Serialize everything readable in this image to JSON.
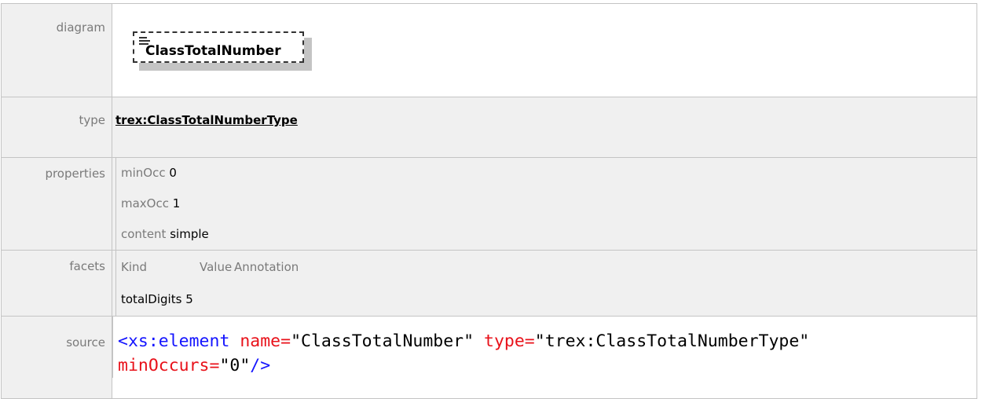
{
  "labels": {
    "diagram": "diagram",
    "type": "type",
    "properties": "properties",
    "facets": "facets",
    "source": "source"
  },
  "diagram": {
    "element_name": "ClassTotalNumber"
  },
  "type": {
    "link_text": "trex:ClassTotalNumberType"
  },
  "properties": [
    {
      "key": "minOcc",
      "value": "0"
    },
    {
      "key": "maxOcc",
      "value": "1"
    },
    {
      "key": "content",
      "value": "simple"
    }
  ],
  "facets": {
    "headers": [
      "Kind",
      "Value",
      "Annotation"
    ],
    "rows": [
      {
        "kind": "totalDigits",
        "value": "5"
      }
    ]
  },
  "source": {
    "line1": {
      "open": "<xs:element ",
      "attr1": "name=",
      "val1": "\"ClassTotalNumber\"",
      "attr2": " type=",
      "val2": "\"trex:ClassTotalNumberType\""
    },
    "line2": {
      "attr3": "minOccurs=",
      "val3": "\"0\"",
      "close": "/>"
    }
  },
  "colors": {
    "tag": "#1414ff",
    "attr": "#e8111a",
    "label": "#7a7a7a",
    "row_bg": "#f0f0f0",
    "border": "#c4c4c4"
  }
}
